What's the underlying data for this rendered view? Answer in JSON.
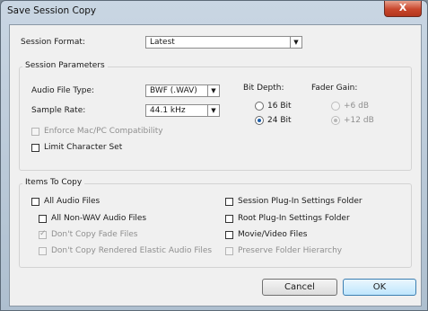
{
  "window": {
    "title": "Save Session Copy",
    "close_label": "X"
  },
  "session_format": {
    "label": "Session Format:",
    "value": "Latest"
  },
  "session_parameters": {
    "title": "Session Parameters",
    "audio_file_type": {
      "label": "Audio File Type:",
      "value": "BWF (.WAV)"
    },
    "sample_rate": {
      "label": "Sample Rate:",
      "value": "44.1 kHz"
    },
    "bit_depth": {
      "label": "Bit Depth:",
      "option_16": "16 Bit",
      "option_24": "24 Bit",
      "selected": "24 Bit"
    },
    "fader_gain": {
      "label": "Fader Gain:",
      "option_plus6": "+6 dB",
      "option_plus12": "+12 dB",
      "selected": "+12 dB"
    },
    "enforce_compat": {
      "label": "Enforce Mac/PC Compatibility",
      "checked": false,
      "enabled": false
    },
    "limit_charset": {
      "label": "Limit Character Set",
      "checked": false,
      "enabled": true
    }
  },
  "items_to_copy": {
    "title": "Items To Copy",
    "all_audio_files": {
      "label": "All Audio Files",
      "checked": false
    },
    "all_non_wav": {
      "label": "All Non-WAV Audio Files",
      "checked": false
    },
    "dont_copy_fade": {
      "label": "Don't Copy Fade Files",
      "checked": true,
      "enabled": false
    },
    "dont_copy_elastic": {
      "label": "Don't Copy Rendered Elastic Audio Files",
      "checked": false,
      "enabled": false
    },
    "session_plugin_settings": {
      "label": "Session Plug-In Settings Folder",
      "checked": false
    },
    "root_plugin_settings": {
      "label": "Root Plug-In Settings Folder",
      "checked": false
    },
    "movie_video": {
      "label": "Movie/Video Files",
      "checked": false
    },
    "preserve_hierarchy": {
      "label": "Preserve Folder Hierarchy",
      "checked": false,
      "enabled": false
    }
  },
  "buttons": {
    "cancel": "Cancel",
    "ok": "OK"
  }
}
